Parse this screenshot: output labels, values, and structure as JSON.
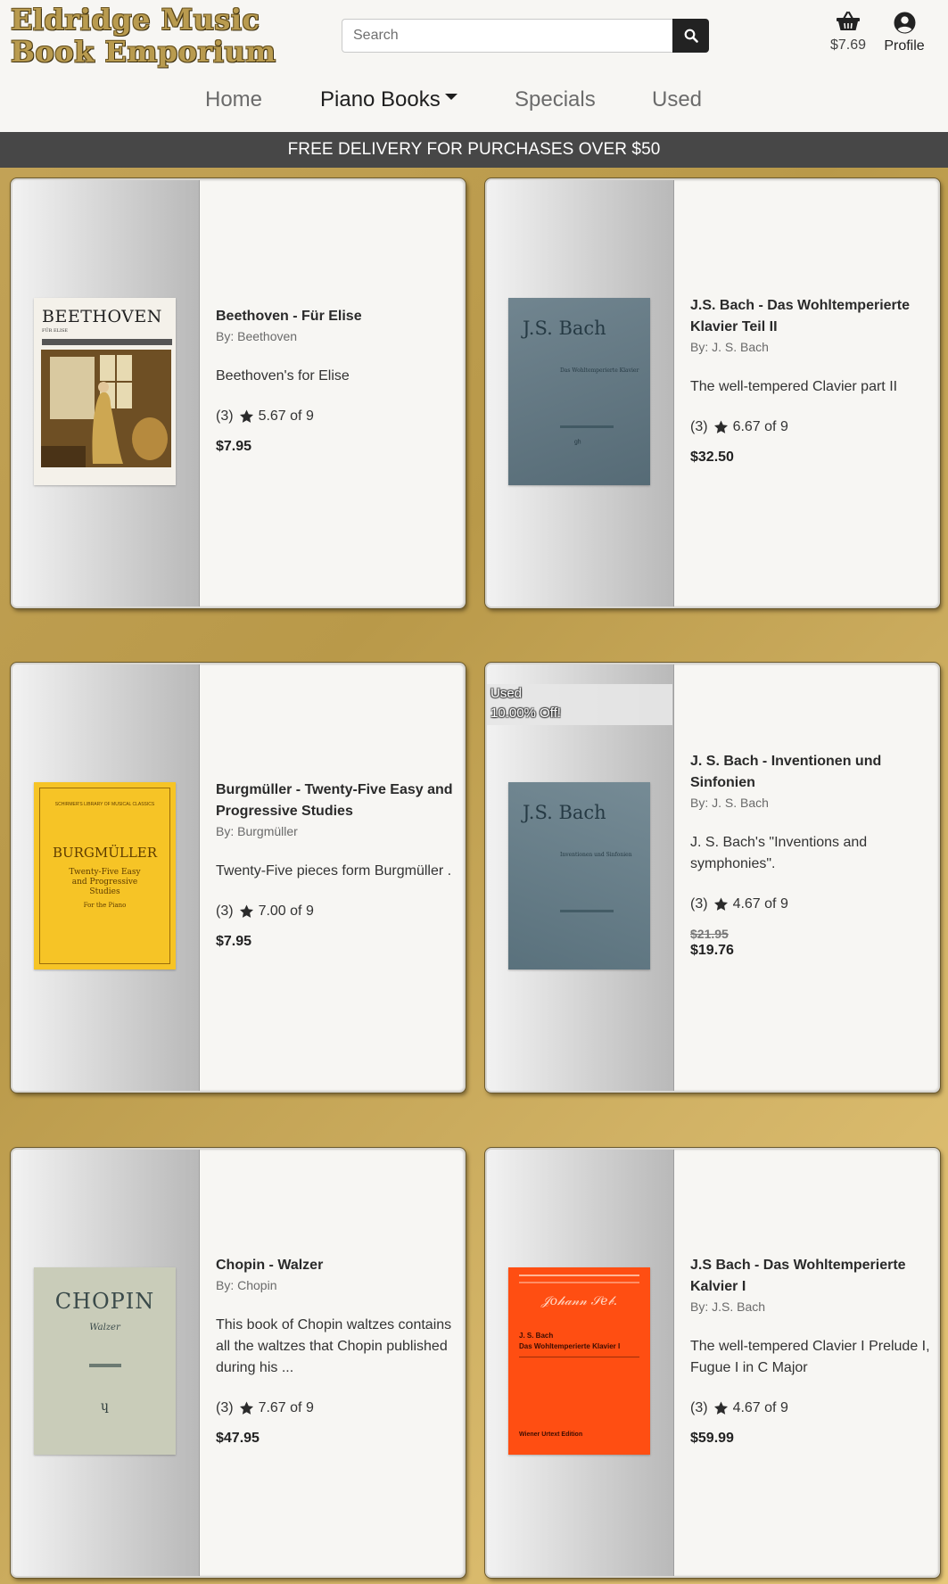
{
  "header": {
    "logo_line1": "Eldridge Music",
    "logo_line2": "Book Emporium",
    "search_placeholder": "Search",
    "cart_amount": "$7.69",
    "profile_label": "Profile"
  },
  "nav": {
    "home": "Home",
    "piano_books": "Piano Books",
    "specials": "Specials",
    "used": "Used"
  },
  "banner": "FREE DELIVERY FOR PURCHASES OVER $50",
  "products": [
    {
      "title": "Beethoven - Für Elise",
      "author": "By: Beethoven",
      "description": "Beethoven's for Elise",
      "rating_count": "(3)",
      "rating": "5.67 of 9",
      "price": "$7.95",
      "cover": {
        "title": "BEETHOVEN",
        "subtitle": "FÜR ELISE"
      }
    },
    {
      "title": "J.S. Bach - Das Wohltemperierte Klavier Teil II",
      "author": "By: J. S. Bach",
      "description": "The well-tempered Clavier part II",
      "rating_count": "(3)",
      "rating": "6.67 of 9",
      "price": "$32.50",
      "cover": {
        "title": "J.S. Bach",
        "subtitle": "Das Wohltemperierte Klavier"
      }
    },
    {
      "title": "Burgmüller - Twenty-Five Easy and Progressive Studies",
      "author": "By: Burgmüller",
      "description": "Twenty-Five pieces form Burgmüller .",
      "rating_count": "(3)",
      "rating": "7.00 of 9",
      "price": "$7.95",
      "cover": {
        "series": "SCHIRMER'S LIBRARY OF MUSICAL CLASSICS",
        "title": "BURGMÜLLER",
        "subtitle": "Twenty-Five Easy and Progressive Studies",
        "note": "For the Piano"
      }
    },
    {
      "title": "J. S. Bach - Inventionen und Sinfonien",
      "author": "By: J. S. Bach",
      "description": "J. S. Bach's \"Inventions and symphonies\".",
      "rating_count": "(3)",
      "rating": "4.67 of 9",
      "old_price": "$21.95",
      "price": "$19.76",
      "badge_line1": "Used",
      "badge_line2": "10.00% Off!",
      "cover": {
        "title": "J.S. Bach",
        "subtitle": "Inventionen und Sinfonien"
      }
    },
    {
      "title": "Chopin - Walzer",
      "author": "By: Chopin",
      "description": "This book of Chopin waltzes contains all the waltzes that Chopin published during his ...",
      "rating_count": "(3)",
      "rating": "7.67 of 9",
      "price": "$47.95",
      "cover": {
        "title": "CHOPIN",
        "subtitle": "Walzer"
      }
    },
    {
      "title": "J.S Bach - Das Wohltemperierte Kalvier I",
      "author": "By: J.S. Bach",
      "description": "The well-tempered Clavier I Prelude I, Fugue I in C Major",
      "rating_count": "(3)",
      "rating": "4.67 of 9",
      "price": "$59.99",
      "cover": {
        "title": "J. S. Bach",
        "subtitle": "Das Wohltemperierte Klavier I",
        "edition": "Wiener Urtext Edition"
      }
    }
  ],
  "colors": {
    "accent_gold": "#b99b4f",
    "banner_bg": "#474747",
    "search_button": "#222222"
  }
}
